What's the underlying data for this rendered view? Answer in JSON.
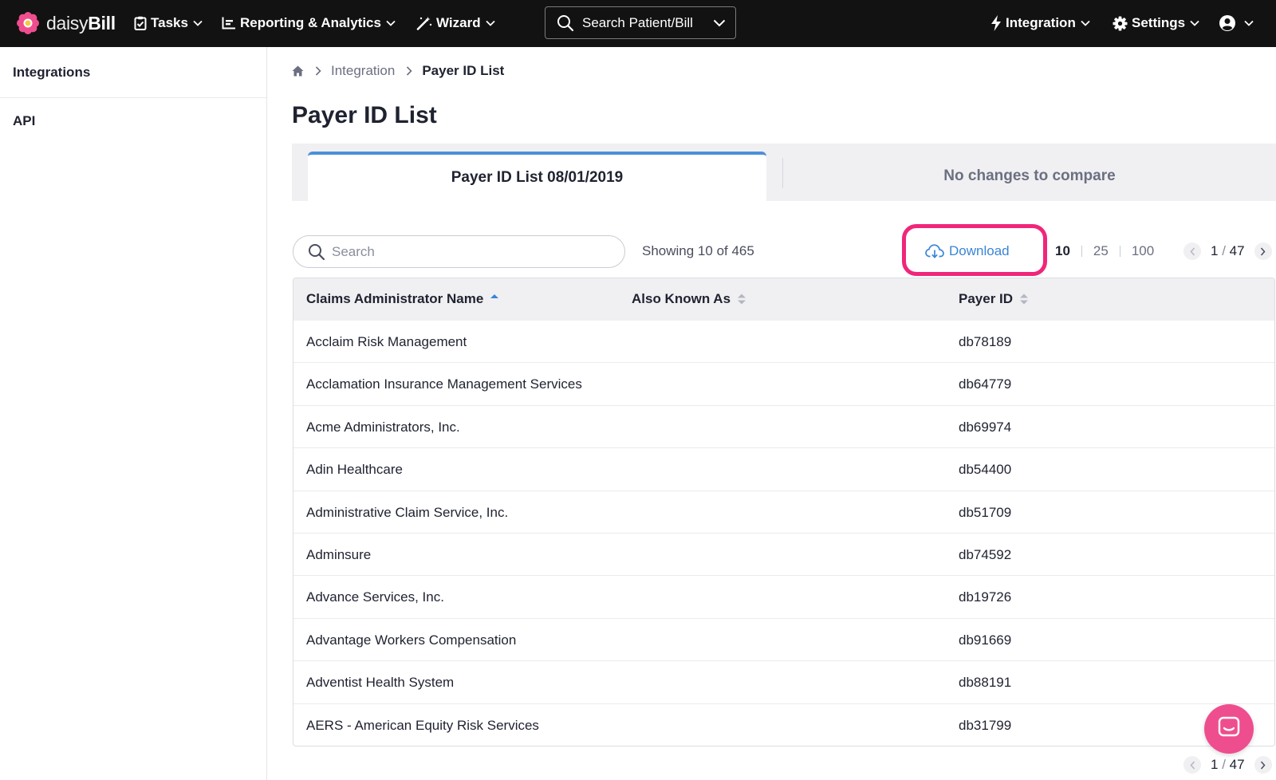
{
  "brand": {
    "name_light": "daisy",
    "name_bold": "Bill",
    "accent": "#ef4e8e"
  },
  "nav": {
    "tasks": "Tasks",
    "reporting": "Reporting & Analytics",
    "wizard": "Wizard",
    "search_patient_bill": "Search Patient/Bill",
    "integration": "Integration",
    "settings": "Settings"
  },
  "sidebar": {
    "items": [
      {
        "label": "Integrations"
      },
      {
        "label": "API"
      }
    ]
  },
  "breadcrumb": {
    "link": "Integration",
    "current": "Payer ID List"
  },
  "page_title": "Payer ID List",
  "tabs": {
    "active": "Payer ID List 08/01/2019",
    "compare": "No changes to compare"
  },
  "toolbar": {
    "search_placeholder": "Search",
    "showing": "Showing 10 of 465",
    "download": "Download",
    "page_sizes": [
      "10",
      "25",
      "100"
    ],
    "active_page_size": "10"
  },
  "pager": {
    "current": "1",
    "total": "47"
  },
  "table": {
    "columns": [
      "Claims Administrator Name",
      "Also Known As",
      "Payer ID"
    ],
    "rows": [
      {
        "name": "Acclaim Risk Management",
        "aka": "",
        "payer_id": "db78189"
      },
      {
        "name": "Acclamation Insurance Management Services",
        "aka": "",
        "payer_id": "db64779"
      },
      {
        "name": "Acme Administrators, Inc.",
        "aka": "",
        "payer_id": "db69974"
      },
      {
        "name": "Adin Healthcare",
        "aka": "",
        "payer_id": "db54400"
      },
      {
        "name": "Administrative Claim Service, Inc.",
        "aka": "",
        "payer_id": "db51709"
      },
      {
        "name": "Adminsure",
        "aka": "",
        "payer_id": "db74592"
      },
      {
        "name": "Advance Services, Inc.",
        "aka": "",
        "payer_id": "db19726"
      },
      {
        "name": "Advantage Workers Compensation",
        "aka": "",
        "payer_id": "db91669"
      },
      {
        "name": "Adventist Health System",
        "aka": "",
        "payer_id": "db88191"
      },
      {
        "name": "AERS - American Equity Risk Services",
        "aka": "",
        "payer_id": "db31799"
      }
    ]
  },
  "colors": {
    "topbar": "#121212",
    "link_blue": "#3a85d6",
    "tab_accent": "#4a90d9",
    "highlight": "#f0267a"
  }
}
